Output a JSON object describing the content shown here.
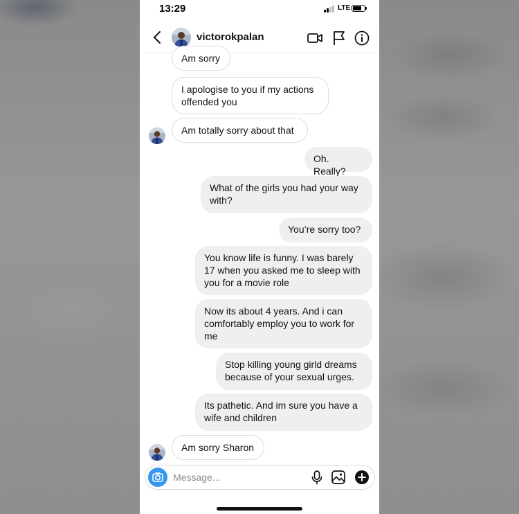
{
  "status_bar": {
    "time": "13:29",
    "network": "LTE"
  },
  "header": {
    "username": "victorokpalan",
    "back_icon": "chevron-left-icon",
    "icons": [
      "video-call-icon",
      "flag-icon",
      "info-icon"
    ]
  },
  "messages": [
    {
      "sender": "them",
      "text": "Am sorry",
      "show_avatar": false
    },
    {
      "sender": "them",
      "text": "I apologise to you if my actions offended you",
      "show_avatar": false
    },
    {
      "sender": "them",
      "text": "Am totally sorry about that",
      "show_avatar": true
    },
    {
      "sender": "me",
      "text": "Oh. Really?"
    },
    {
      "sender": "me",
      "text": "What of the girls you had your way with?"
    },
    {
      "sender": "me",
      "text": "You’re sorry too?"
    },
    {
      "sender": "me",
      "text": "You know life is funny. I was barely 17 when you asked me to sleep with you for a movie role"
    },
    {
      "sender": "me",
      "text": "Now its about 4 years. And i can comfortably employ you to work for me"
    },
    {
      "sender": "me",
      "text": "Stop killing young girld dreams because of your sexual urges."
    },
    {
      "sender": "me",
      "text": "Its pathetic. And im sure you have a wife and children"
    },
    {
      "sender": "them",
      "text": "Am sorry Sharon",
      "show_avatar": true
    }
  ],
  "composer": {
    "placeholder": "Message...",
    "value": "",
    "icons": [
      "camera-icon",
      "microphone-icon",
      "gallery-icon",
      "plus-icon"
    ]
  },
  "colors": {
    "camera_button": "#3797f0",
    "outgoing_bubble": "#efefef",
    "incoming_border": "#dcdcdc",
    "backdrop": "#8f8f8f"
  }
}
